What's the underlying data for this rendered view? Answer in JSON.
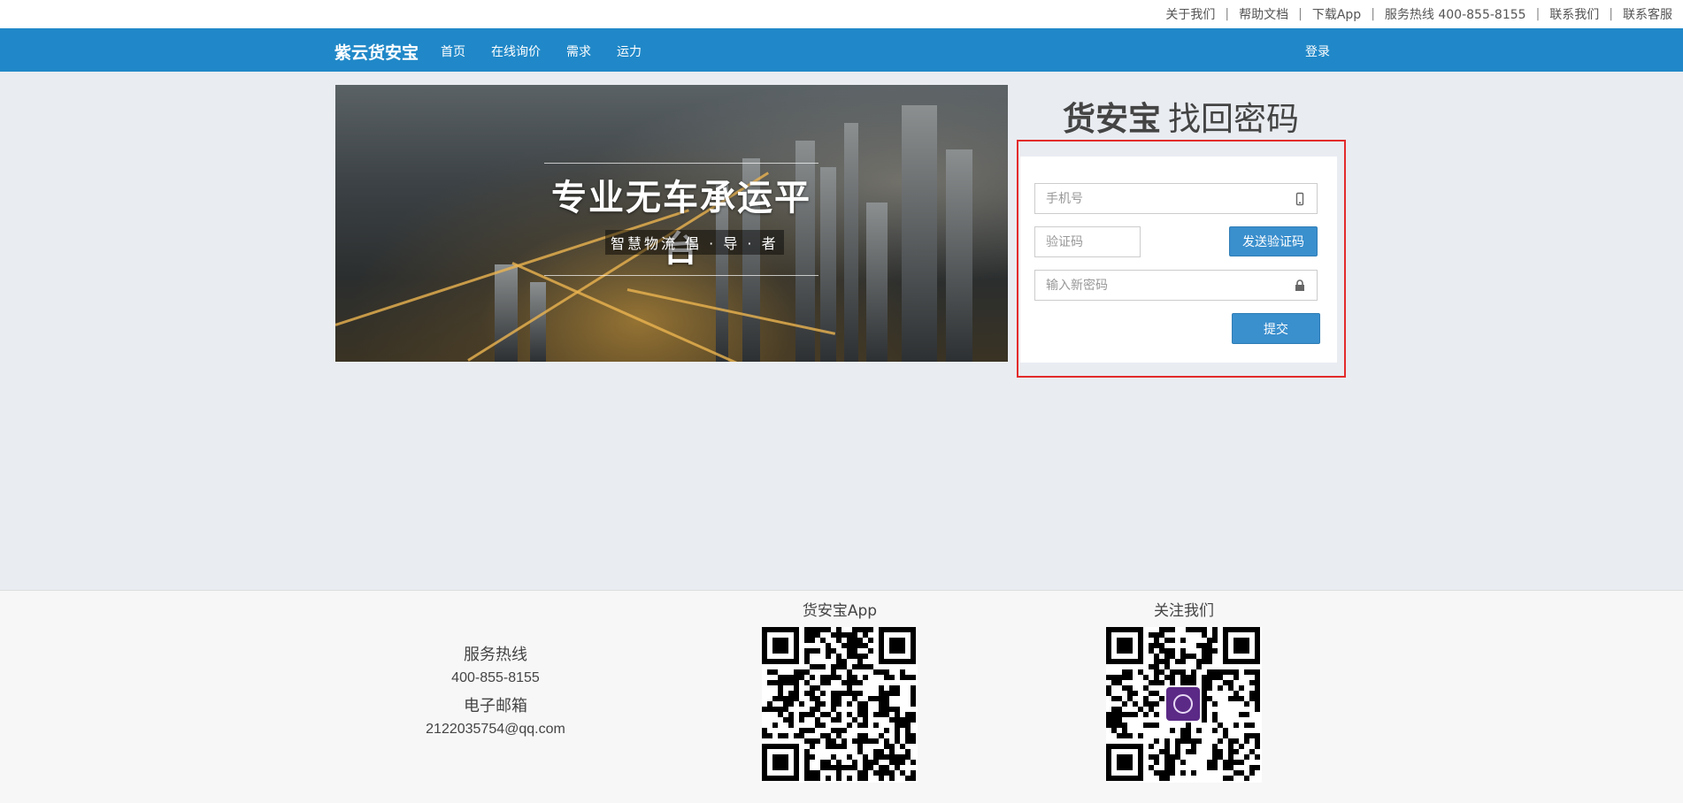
{
  "topbar": {
    "links": [
      "关于我们",
      "帮助文档",
      "下载App",
      "服务热线 400-855-8155",
      "联系我们",
      "联系客服"
    ],
    "separator": "|"
  },
  "navbar": {
    "brand": "紫云货安宝",
    "links": [
      "首页",
      "在线询价",
      "需求",
      "运力"
    ],
    "login": "登录"
  },
  "banner": {
    "title": "专业无车承运平台",
    "subtitle": "智慧物流 倡 · 导 · 者"
  },
  "form": {
    "title_bold": "货安宝",
    "title_rest": "找回密码",
    "phone_placeholder": "手机号",
    "code_placeholder": "验证码",
    "send_code_label": "发送验证码",
    "password_placeholder": "输入新密码",
    "submit_label": "提交",
    "icons": [
      "phone-icon",
      "lock-icon"
    ]
  },
  "footer": {
    "hotline_label": "服务热线",
    "hotline_value": "400-855-8155",
    "email_label": "电子邮箱",
    "email_value": "2122035754@qq.com",
    "app_caption": "货安宝App",
    "follow_caption": "关注我们"
  },
  "colors": {
    "navbar": "#2088c8",
    "button": "#3a8fcd",
    "highlight_frame": "#e32b2b",
    "page_bg": "#e9ecf1"
  }
}
